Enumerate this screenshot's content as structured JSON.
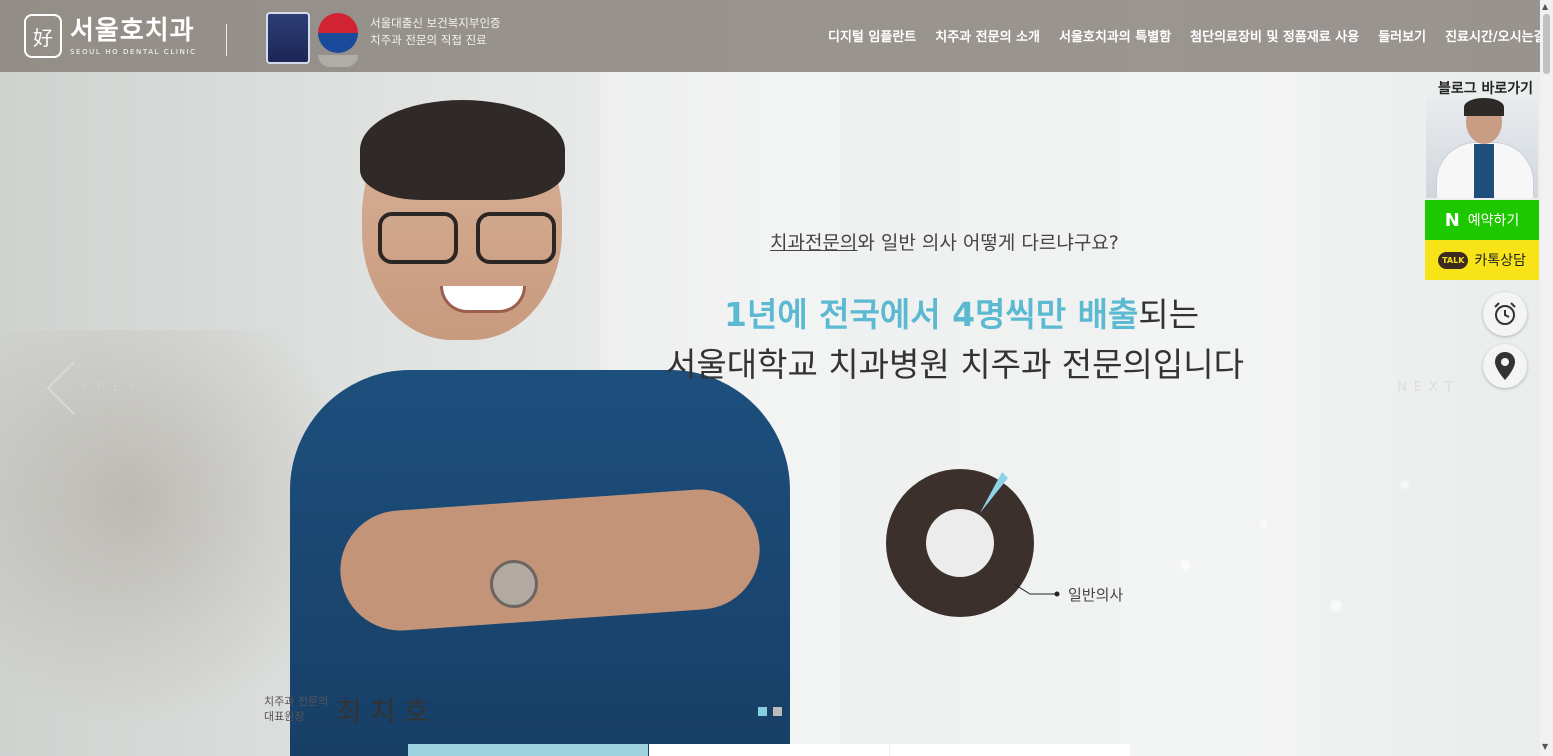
{
  "header": {
    "logo_mark": "好",
    "logo_title": "서울호치과",
    "logo_subtitle": "SEOUL HO DENTAL CLINIC",
    "cert_line1": "서울대출신 보건복지부인증",
    "cert_line2": "치주과 전문의 직접 진료"
  },
  "nav": {
    "items": [
      "디지털 임플란트",
      "치주과 전문의 소개",
      "서울호치과의 특별함",
      "첨단의료장비 및 정품재료 사용",
      "둘러보기",
      "진료시간/오시는길"
    ]
  },
  "hero": {
    "question_underlined": "치과전문의",
    "question_rest": "와 일반 의사 어떻게 다르냐구요?",
    "headline1_highlight": "1년에 전국에서 4명씩만 배출",
    "headline1_rest": "되는",
    "headline2": "서울대학교 치과병원 치주과 전문의입니다",
    "doctor_role_line1": "치주과 전문의",
    "doctor_role_line2": "대표원장",
    "doctor_name": "최치호",
    "prev_label": "PREV",
    "next_label": "NEXT"
  },
  "chart_data": {
    "type": "pie",
    "labels": [
      "일반의사"
    ],
    "highlight_color": "#8ed3e6",
    "main_color": "#3c302c"
  },
  "side": {
    "blog_label": "블로그 바로가기",
    "naver_mark": "N",
    "naver_label": "예약하기",
    "kakao_badge": "TALK",
    "kakao_label": "카톡상담"
  },
  "slider": {
    "dot_count": 2,
    "active_dot": 1
  },
  "colors": {
    "accent": "#5bb9d1",
    "naver_green": "#1ec800",
    "kakao_yellow": "#f7e317",
    "header_bg": "#827a73"
  }
}
